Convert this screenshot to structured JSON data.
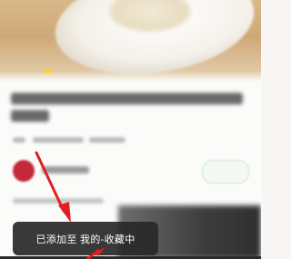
{
  "toast": {
    "message": "已添加至 我的-收藏中"
  },
  "icons": {
    "author_avatar": "avatar-icon",
    "annotation_arrow": "red-arrow"
  },
  "colors": {
    "toast_background": "#282828",
    "annotation_arrow": "#e02020",
    "avatar": "#c4283a"
  }
}
